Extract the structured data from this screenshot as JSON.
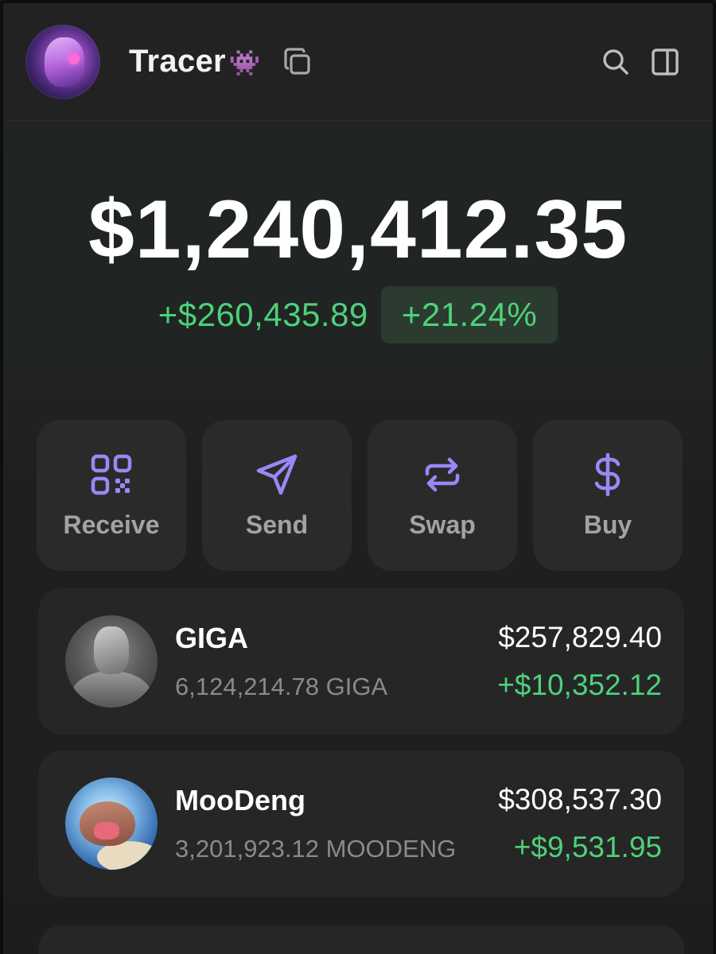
{
  "header": {
    "username": "Tracer",
    "username_emoji": "👾",
    "icons": [
      "copy-icon",
      "search-icon",
      "sidebar-toggle-icon"
    ]
  },
  "portfolio": {
    "balance": "$1,240,412.35",
    "change_amount": "+$260,435.89",
    "change_percent": "+21.24%"
  },
  "actions": [
    {
      "label": "Receive",
      "icon": "qr-code-icon"
    },
    {
      "label": "Send",
      "icon": "paper-plane-icon"
    },
    {
      "label": "Swap",
      "icon": "swap-arrows-icon"
    },
    {
      "label": "Buy",
      "icon": "dollar-icon"
    }
  ],
  "tokens": [
    {
      "name": "GIGA",
      "amount": "6,124,214.78 GIGA",
      "value": "$257,829.40",
      "change": "+$10,352.12"
    },
    {
      "name": "MooDeng",
      "amount": "3,201,923.12 MOODENG",
      "value": "$308,537.30",
      "change": "+$9,531.95"
    }
  ],
  "colors": {
    "accent": "#9b87f5",
    "positive": "#4ed17a",
    "card": "#2a2a2a",
    "background": "#1c1c1c"
  }
}
